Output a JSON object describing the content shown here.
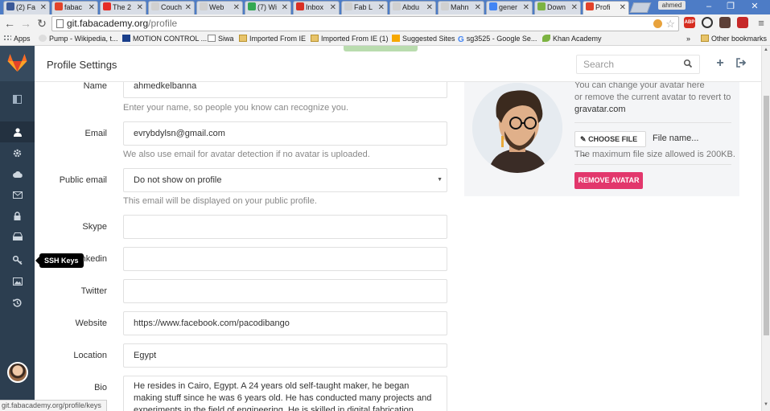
{
  "browser": {
    "tabs": [
      {
        "title": "(2) Fa",
        "color": "#3b5998"
      },
      {
        "title": "fabac",
        "color": "#e2432a"
      },
      {
        "title": "The 2",
        "color": "#e52d27"
      },
      {
        "title": "Couch",
        "color": "#d0d0d0"
      },
      {
        "title": "Web ",
        "color": "#d0d0d0"
      },
      {
        "title": "(7) Wi",
        "color": "#34a853"
      },
      {
        "title": "Inbox",
        "color": "#d93025"
      },
      {
        "title": "Fab L",
        "color": "#d0d0d0"
      },
      {
        "title": "Abdu",
        "color": "#d0d0d0"
      },
      {
        "title": "Mahn",
        "color": "#d0d0d0"
      },
      {
        "title": "gener",
        "color": "#4285f4"
      },
      {
        "title": "Down",
        "color": "#7cb342"
      },
      {
        "title": "Profi",
        "color": "#e2432a"
      }
    ],
    "active_tab": 12,
    "profile_name": "ahmed",
    "url_host": "git.fabacademy.org",
    "url_path": "/profile",
    "bookmarks": [
      {
        "label": "Apps"
      },
      {
        "label": "Pump - Wikipedia, t..."
      },
      {
        "label": "MOTION CONTROL ..."
      },
      {
        "label": "Siwa"
      },
      {
        "label": "Imported From IE"
      },
      {
        "label": "Imported From IE (1)"
      },
      {
        "label": "Suggested Sites"
      },
      {
        "label": "sg3525 - Google Se..."
      },
      {
        "label": "Khan Academy"
      }
    ],
    "bookmarks_overflow": "»",
    "other_bookmarks": "Other bookmarks",
    "status_url": "git.fabacademy.org/profile/keys"
  },
  "header": {
    "title": "Profile Settings",
    "search_placeholder": "Search"
  },
  "sidebar": {
    "tooltip": "SSH Keys"
  },
  "form": {
    "name": {
      "label": "Name",
      "value": "ahmedkelbanna",
      "help": "Enter your name, so people you know can recognize you."
    },
    "email": {
      "label": "Email",
      "value": "evrybdylsn@gmail.com",
      "help": "We also use email for avatar detection if no avatar is uploaded."
    },
    "public_email": {
      "label": "Public email",
      "value": "Do not show on profile",
      "help": "This email will be displayed on your public profile."
    },
    "skype": {
      "label": "Skype",
      "value": ""
    },
    "linkedin": {
      "label": "Linkedin",
      "value": ""
    },
    "twitter": {
      "label": "Twitter",
      "value": ""
    },
    "website": {
      "label": "Website",
      "value": "https://www.facebook.com/pacodibango"
    },
    "location": {
      "label": "Location",
      "value": "Egypt"
    },
    "bio": {
      "label": "Bio",
      "value": "He resides in Cairo, Egypt. A 24 years old self-taught maker, he began making stuff since he was 6 years old. He has conducted many projects and experiments in the field of engineering. He is skilled in digital fabrication."
    }
  },
  "avatar": {
    "line1": "You can change your avatar here",
    "line2": "or remove the current avatar to revert to",
    "line3": "gravatar.com",
    "choose_button": "CHOOSE FILE ...",
    "file_name": "File name...",
    "max_size": "The maximum file size allowed is 200KB.",
    "remove_button": "REMOVE AVATAR"
  }
}
